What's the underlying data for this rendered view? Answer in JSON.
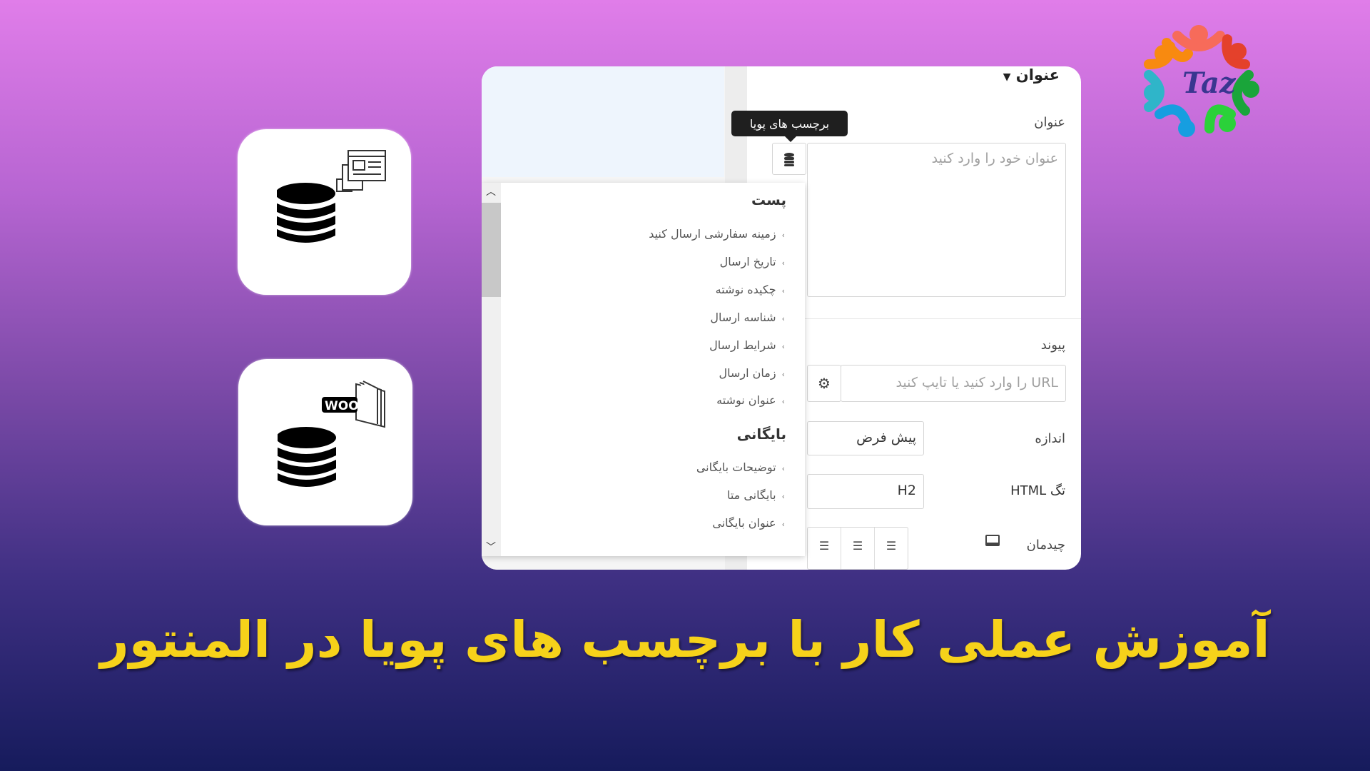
{
  "title": "آموزش عملی کار با برچسب های پویا در المنتور",
  "logo": {
    "text": "Taz"
  },
  "cards": [
    {
      "icon": "database-post-icon"
    },
    {
      "icon": "database-woocommerce-icon",
      "badge": "WOO"
    }
  ],
  "panel": {
    "section_title": "عنوان",
    "title_label": "عنوان",
    "title_placeholder": "عنوان خود را وارد کنید",
    "tooltip": "برچسب های پویا",
    "link_label": "پیوند",
    "link_placeholder": "URL را وارد کنید یا تایپ کنید",
    "size_label": "اندازه",
    "size_value": "پیش فرض",
    "html_tag_label": "تگ HTML",
    "html_tag_value": "H2",
    "alignment_label": "چیدمان"
  },
  "dropdown": {
    "groups": [
      {
        "heading": "پست",
        "items": [
          "زمینه سفارشی ارسال کنید",
          "تاریخ ارسال",
          "چکیده نوشته",
          "شناسه ارسال",
          "شرایط ارسال",
          "زمان ارسال",
          "عنوان نوشته"
        ]
      },
      {
        "heading": "بایگانی",
        "items": [
          "توضیحات بایگانی",
          "بایگانی متا",
          "عنوان بایگانی"
        ]
      }
    ]
  }
}
